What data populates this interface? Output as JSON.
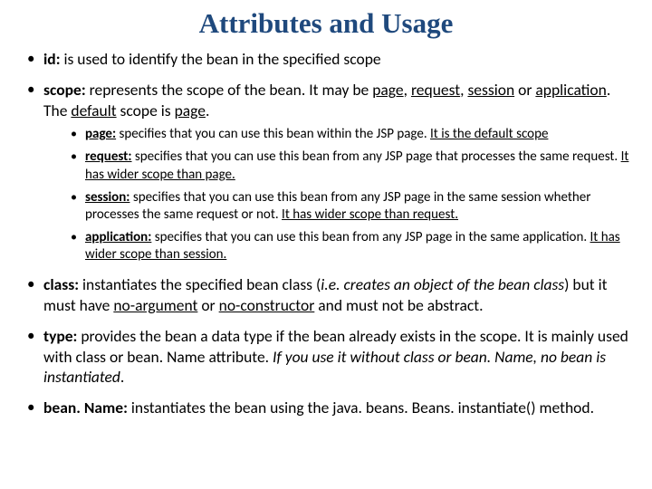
{
  "title": "Attributes and Usage",
  "items": [
    {
      "label": "id:",
      "text": " is used to identify the bean in the specified scope"
    },
    {
      "label": "scope:",
      "text_a": " represents the scope of the bean. It may be ",
      "u1": "page",
      "u2": "request",
      "u3": "session",
      "u4": "application",
      "text_b": " or ",
      "text_c": ". The ",
      "u5": "default",
      "text_d": " scope is ",
      "u6": "page",
      "text_e": ".",
      "sub": [
        {
          "label": "page:",
          "t": " specifies that you can use this bean within the JSP page. ",
          "u": "It is the default scope"
        },
        {
          "label": "request:",
          "t": " specifies that you can use this bean from any JSP page that processes the same request. ",
          "u": "It has wider scope than page."
        },
        {
          "label": "session:",
          "t": " specifies that you can use this bean from any JSP page in the same session whether processes the same request or not. ",
          "u": "It has wider scope than request."
        },
        {
          "label": "application:",
          "t": " specifies that you can use this bean from any JSP page in the same application. ",
          "u": "It has wider scope than session."
        }
      ]
    },
    {
      "label": "class:",
      "t1": " instantiates the specified bean class (",
      "i1": "i.e. creates an object of the bean class",
      "t2": ") but it must have ",
      "u1": "no-argument",
      "t3": " or ",
      "u2": "no-constructor",
      "t4": " and must not be abstract."
    },
    {
      "label": "type:",
      "t1": " provides the bean a data type if the bean already exists in the scope. It is mainly used with class or bean. Name attribute. ",
      "i1": "If you use it without class or bean. Name, no bean is instantiated",
      "t2": "."
    },
    {
      "label": "bean. Name:",
      "t1": " instantiates the bean using the java. beans. Beans. instantiate() method."
    }
  ]
}
